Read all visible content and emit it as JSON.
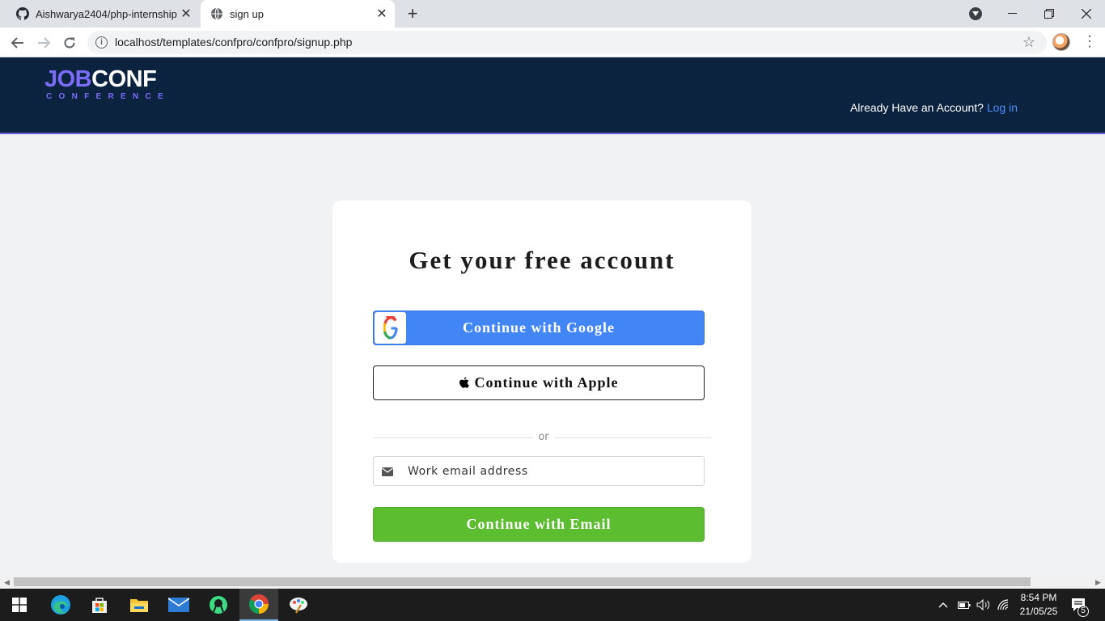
{
  "browser": {
    "tabs": [
      {
        "title": "Aishwarya2404/php-internship",
        "icon": "github-icon",
        "active": false
      },
      {
        "title": "sign up",
        "icon": "globe-icon",
        "active": true
      }
    ],
    "url": "localhost/templates/confpro/confpro/signup.php"
  },
  "header": {
    "logo_part1": "JOB",
    "logo_part2": "CONF",
    "logo_sub": "CONFERENCE",
    "account_prompt": "Already Have an Account?",
    "login_link": "Log in"
  },
  "card": {
    "title": "Get your free account",
    "google_label": "Continue with Google",
    "apple_label": "Continue with Apple",
    "divider_text": "or",
    "email_placeholder": "Work email address",
    "email_button_label": "Continue with Email"
  },
  "taskbar": {
    "time": "8:54 PM",
    "date": "21/05/25",
    "notification_count": "5"
  },
  "colors": {
    "header_bg": "#0c2340",
    "accent_purple": "#7b6cf6",
    "google_blue": "#4285f4",
    "email_green": "#5cbd31",
    "link_blue": "#4f8ef7"
  }
}
